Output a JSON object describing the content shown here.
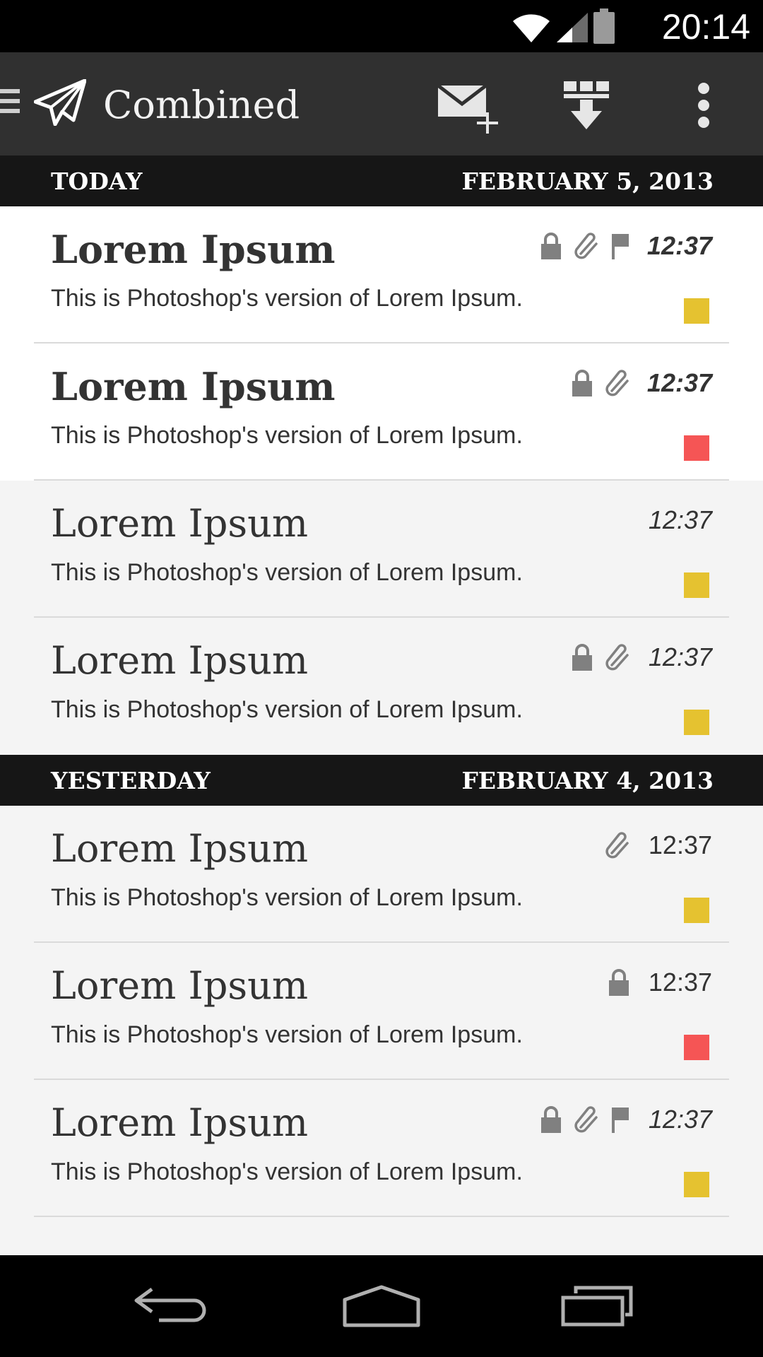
{
  "status_bar": {
    "time": "20:14",
    "icons": [
      "wifi-icon",
      "cell-signal-icon",
      "battery-icon"
    ]
  },
  "action_bar": {
    "title": "Combined",
    "actions": [
      "compose-icon",
      "download-icon",
      "overflow-menu-icon"
    ]
  },
  "colors": {
    "yellow": "#e5c230",
    "red": "#f55555",
    "header_bg": "#161616",
    "action_bar_bg": "#303030"
  },
  "sections": [
    {
      "label": "TODAY",
      "date": "FEBRUARY 5, 2013",
      "messages": [
        {
          "subject": "Lorem Ipsum",
          "preview": "This is Photoshop's version  of Lorem Ipsum.",
          "time": "12:37",
          "unread": true,
          "icons": [
            "lock-icon",
            "paperclip-icon",
            "flag-icon"
          ],
          "color": "yellow"
        },
        {
          "subject": "Lorem Ipsum",
          "preview": "This is Photoshop's version  of Lorem Ipsum.",
          "time": "12:37",
          "unread": true,
          "icons": [
            "lock-icon",
            "paperclip-icon"
          ],
          "color": "red"
        },
        {
          "subject": "Lorem Ipsum",
          "preview": "This is Photoshop's version  of Lorem Ipsum.",
          "time": "12:37",
          "unread": false,
          "icons": [],
          "color": "yellow"
        },
        {
          "subject": "Lorem Ipsum",
          "preview": "This is Photoshop's version  of Lorem Ipsum.",
          "time": "12:37",
          "unread": false,
          "icons": [
            "lock-icon",
            "paperclip-icon"
          ],
          "color": "yellow"
        }
      ]
    },
    {
      "label": "YESTERDAY",
      "date": "FEBRUARY 4, 2013",
      "messages": [
        {
          "subject": "Lorem Ipsum",
          "preview": "This is Photoshop's version  of Lorem Ipsum.",
          "time": "12:37",
          "unread": false,
          "icons": [
            "paperclip-icon"
          ],
          "color": "yellow"
        },
        {
          "subject": "Lorem Ipsum",
          "preview": "This is Photoshop's version  of Lorem Ipsum.",
          "time": "12:37",
          "unread": false,
          "icons": [
            "lock-icon"
          ],
          "color": "red"
        },
        {
          "subject": "Lorem Ipsum",
          "preview": "This is Photoshop's version  of Lorem Ipsum.",
          "time": "12:37",
          "unread": false,
          "icons": [
            "lock-icon",
            "paperclip-icon",
            "flag-icon"
          ],
          "color": "yellow"
        }
      ]
    }
  ],
  "nav_bar": {
    "buttons": [
      "back-icon",
      "home-icon",
      "recents-icon"
    ]
  }
}
